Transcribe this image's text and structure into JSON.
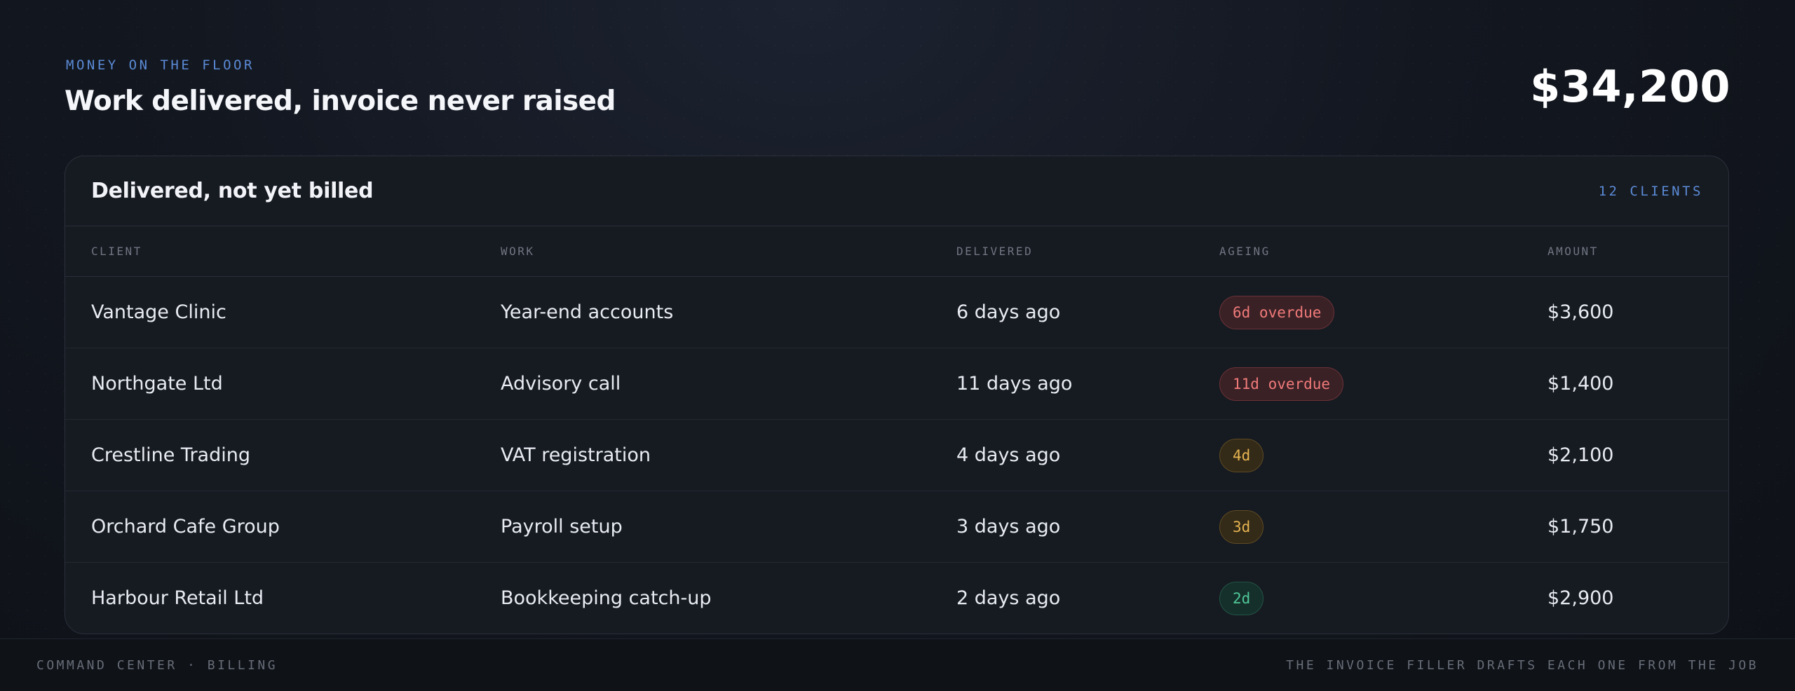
{
  "header": {
    "eyebrow": "MONEY ON THE FLOOR",
    "title": "Work delivered, invoice never raised",
    "total": "$34,200"
  },
  "card": {
    "title": "Delivered, not yet billed",
    "count": "12 CLIENTS",
    "columns": [
      "CLIENT",
      "WORK",
      "DELIVERED",
      "AGEING",
      "AMOUNT"
    ],
    "rows": [
      {
        "client": "Vantage Clinic",
        "work": "Year-end accounts",
        "delivered": "6 days ago",
        "ageing": "6d overdue",
        "status": "red",
        "amount": "$3,600"
      },
      {
        "client": "Northgate Ltd",
        "work": "Advisory call",
        "delivered": "11 days ago",
        "ageing": "11d overdue",
        "status": "red",
        "amount": "$1,400"
      },
      {
        "client": "Crestline Trading",
        "work": "VAT registration",
        "delivered": "4 days ago",
        "ageing": "4d",
        "status": "amber",
        "amount": "$2,100"
      },
      {
        "client": "Orchard Cafe Group",
        "work": "Payroll setup",
        "delivered": "3 days ago",
        "ageing": "3d",
        "status": "amber",
        "amount": "$1,750"
      },
      {
        "client": "Harbour Retail Ltd",
        "work": "Bookkeeping catch-up",
        "delivered": "2 days ago",
        "ageing": "2d",
        "status": "green",
        "amount": "$2,900"
      }
    ]
  },
  "footer": {
    "left": "COMMAND CENTER · BILLING",
    "right": "THE INVOICE FILLER DRAFTS EACH ONE FROM THE JOB"
  },
  "colors": {
    "accent": "#5b8bd6",
    "overdue": "#f07a7a",
    "warning": "#e6b450",
    "ok": "#4fc79a"
  }
}
